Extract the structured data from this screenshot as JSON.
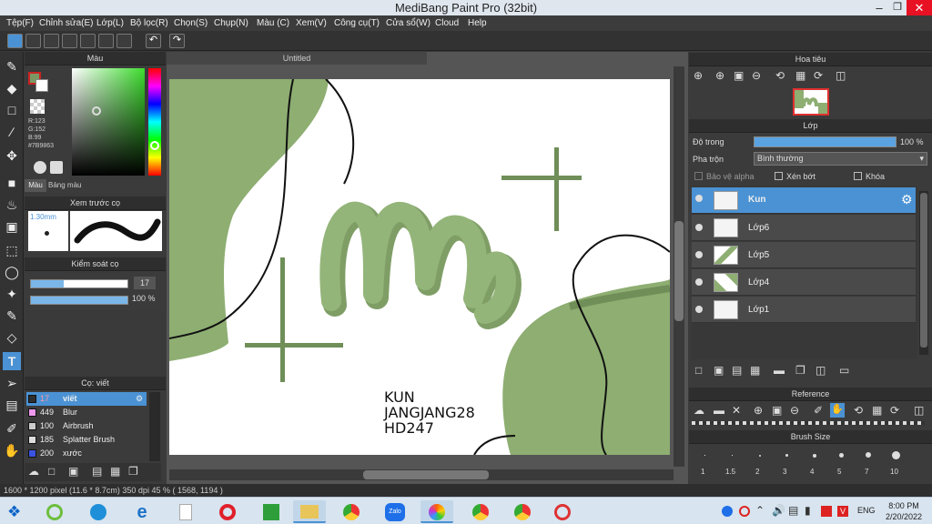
{
  "app_title": "MediBang Paint Pro (32bit)",
  "menu": [
    "Tệp(F)",
    "Chỉnh sửa(E)",
    "Lớp(L)",
    "Bộ lọc(R)",
    "Chọn(S)",
    "Chụp(N)",
    "Màu (C)",
    "Xem(V)",
    "Công cụ(T)",
    "Cửa sổ(W)",
    "Cloud",
    "Help"
  ],
  "color_panel": {
    "title": "Màu",
    "r": "R:123",
    "g": "G:152",
    "b": "B:99",
    "hex": "#7B9863",
    "tab1": "Màu",
    "tab2": "Bảng màu",
    "primary": "#7B9863"
  },
  "preview_panel": {
    "title": "Xem trước cọ",
    "size": "1.30mm"
  },
  "brush_control": {
    "title": "Kiểm soát cọ",
    "size": "17",
    "opacity": "100 %",
    "size_fraction": 0.17,
    "opacity_fraction": 1.0
  },
  "brush_list": {
    "title": "Cọ: viết",
    "items": [
      {
        "size": "17",
        "name": "viết",
        "color": "#2e2e2e"
      },
      {
        "size": "449",
        "name": "Blur",
        "color": "#ee99ee"
      },
      {
        "size": "100",
        "name": "Airbrush",
        "color": "#cccccc"
      },
      {
        "size": "185",
        "name": "Splatter Brush",
        "color": "#dddddd"
      },
      {
        "size": "200",
        "name": "xước",
        "color": "#3a54e0"
      }
    ]
  },
  "document_tab": "Untitled",
  "canvas_text": {
    "line1": "KUN",
    "line2": "JANGJANG28",
    "line3": "HD247"
  },
  "navigator": {
    "title": "Hoa tiêu"
  },
  "layer_panel": {
    "title": "Lớp",
    "opacity_label": "Độ trong",
    "opacity_value": "100 %",
    "opacity_fraction": 1.0,
    "blend_label": "Pha trộn",
    "blend_value": "Bình thường",
    "protect_alpha": "Bảo vệ alpha",
    "clip": "Xén bớt",
    "lock": "Khóa",
    "layers": [
      {
        "name": "Kun"
      },
      {
        "name": "Lớp6"
      },
      {
        "name": "Lớp5"
      },
      {
        "name": "Lớp4"
      },
      {
        "name": "Lớp1"
      }
    ]
  },
  "reference": {
    "title": "Reference"
  },
  "brush_size": {
    "title": "Brush Size",
    "sizes": [
      "1",
      "1.5",
      "2",
      "3",
      "4",
      "5",
      "7",
      "10"
    ]
  },
  "status": "1600 * 1200 pixel  (11.6 * 8.7cm)  350 dpi  45 %  ( 1568, 1194 )",
  "taskbar": {
    "lang": "ENG",
    "time": "8:00 PM",
    "date": "2/20/2022"
  },
  "accent": "#4a92d4",
  "art_green": "#8eae72"
}
